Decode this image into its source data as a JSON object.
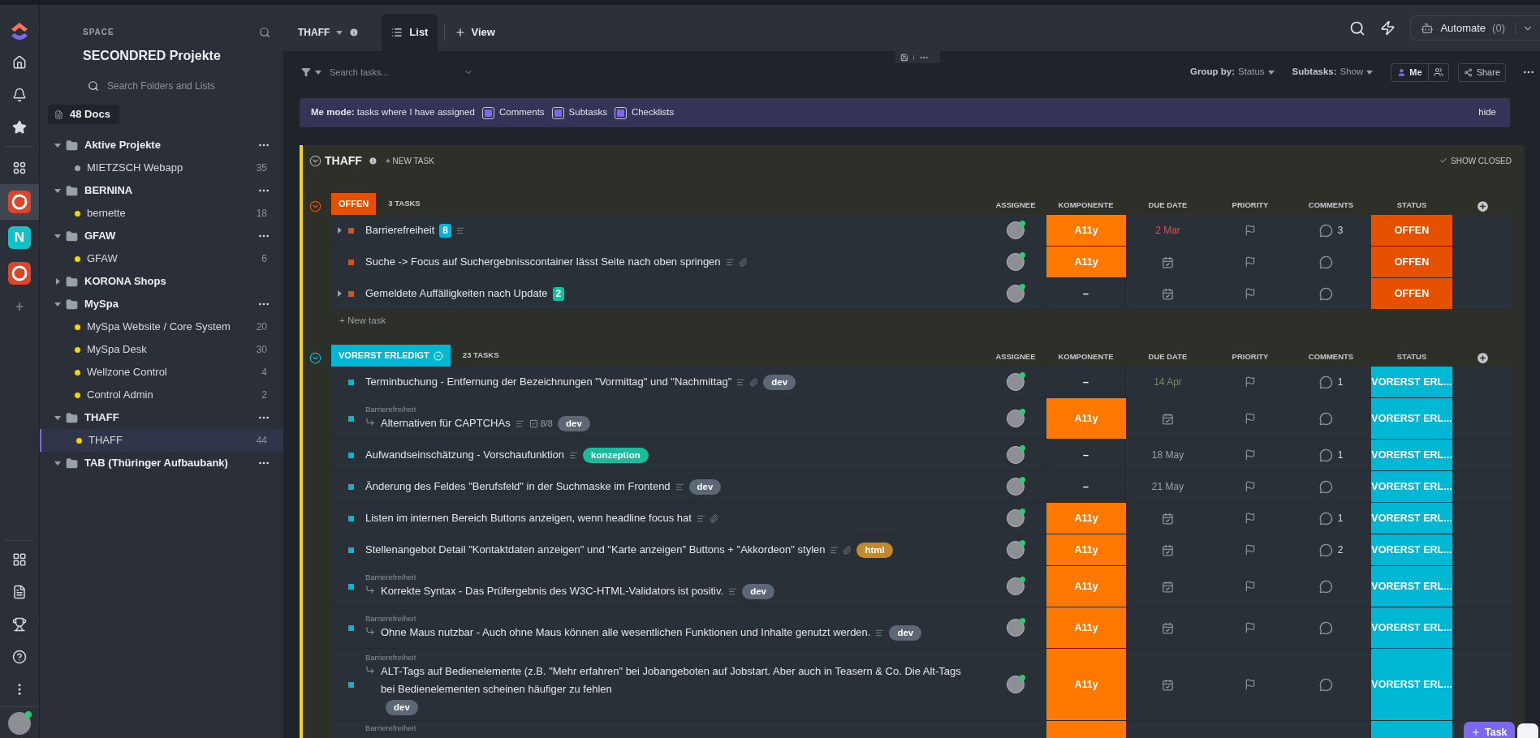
{
  "rail": {
    "spaces": [
      {
        "kind": "logo",
        "selected": true
      },
      {
        "kind": "letter",
        "text": "N",
        "selected": false
      },
      {
        "kind": "logo",
        "selected": false
      }
    ]
  },
  "sidebar": {
    "label": "SPACE",
    "title": "SECONDRED Projekte",
    "search_placeholder": "Search Folders and Lists",
    "docs": "48 Docs",
    "folders": [
      {
        "name": "Aktive Projekte",
        "expanded": true,
        "more": true,
        "children": [
          {
            "name": "MIETZSCH Webapp",
            "count": "35",
            "color": "#a8a0a6",
            "selected": false
          }
        ]
      },
      {
        "name": "BERNINA",
        "expanded": true,
        "more": true,
        "children": [
          {
            "name": "bernette",
            "count": "18",
            "color": "#f5d40f",
            "selected": false
          }
        ]
      },
      {
        "name": "GFAW",
        "expanded": true,
        "more": true,
        "children": [
          {
            "name": "GFAW",
            "count": "6",
            "color": "#f5d40f",
            "selected": false
          }
        ]
      },
      {
        "name": "KORONA Shops",
        "expanded": false,
        "more": false
      },
      {
        "name": "MySpa",
        "expanded": true,
        "more": true,
        "children": [
          {
            "name": "MySpa Website / Core System",
            "count": "20",
            "color": "#f5d40f",
            "selected": false
          },
          {
            "name": "MySpa Desk",
            "count": "30",
            "color": "#f5d40f",
            "selected": false
          },
          {
            "name": "Wellzone Control",
            "count": "4",
            "color": "#f5d40f",
            "selected": false
          },
          {
            "name": "Control Admin",
            "count": "2",
            "color": "#f5d40f",
            "selected": false
          }
        ]
      },
      {
        "name": "THAFF",
        "expanded": true,
        "more": true,
        "children": [
          {
            "name": "THAFF",
            "count": "44",
            "color": "#f5d40f",
            "selected": true
          }
        ]
      },
      {
        "name": "TAB (Thüringer Aufbaubank)",
        "expanded": true,
        "more": true
      }
    ]
  },
  "header": {
    "list_name": "THAFF",
    "tabs": [
      {
        "label": "List",
        "selected": true
      }
    ],
    "add_view": "View",
    "automate": {
      "label": "Automate",
      "count": "(0)"
    }
  },
  "toolbar": {
    "search_placeholder": "Search tasks...",
    "group_by": {
      "label": "Group by:",
      "value": "Status"
    },
    "subtasks": {
      "label": "Subtasks:",
      "value": "Show"
    },
    "me": "Me",
    "share": "Share"
  },
  "me_mode": {
    "text": "**Me mode:** tasks where I have assigned",
    "options": [
      {
        "label": "Comments",
        "checked": true
      },
      {
        "label": "Subtasks",
        "checked": true
      },
      {
        "label": "Checklists",
        "checked": true
      }
    ],
    "hide": "hide"
  },
  "list": {
    "title": "THAFF",
    "new_task": "+ NEW TASK",
    "show_closed": "SHOW CLOSED",
    "groups": [
      {
        "status": "OFFEN",
        "color": "#e65100",
        "done": false,
        "count": "3 TASKS",
        "columns": [
          "ASSIGNEE",
          "KOMPONENTE",
          "DUE DATE",
          "PRIORITY",
          "COMMENTS",
          "STATUS"
        ],
        "new_task": "+ New task",
        "tasks": [
          {
            "name": "Barrierefreiheit",
            "expandable": true,
            "subtasks": {
              "text": "8",
              "color": "#00b5d8"
            },
            "description": true,
            "attachment": false,
            "komponente": {
              "text": "A11y",
              "color": "#ff7800"
            },
            "due": {
              "text": "2 Mar",
              "kind": "overdue"
            },
            "comments": "3",
            "status": "OFFEN"
          },
          {
            "name": "Suche -> Focus auf Suchergebnisscontainer lässt Seite nach oben springen",
            "expandable": false,
            "description": true,
            "attachment": true,
            "komponente": {
              "text": "A11y",
              "color": "#ff7800"
            },
            "status": "OFFEN"
          },
          {
            "name": "Gemeldete Auffälligkeiten nach Update",
            "expandable": true,
            "subtasks": {
              "text": "2",
              "color": "#1bbc9c"
            },
            "description": false,
            "attachment": false,
            "komponente": {
              "text": "–"
            },
            "status": "OFFEN"
          }
        ]
      },
      {
        "status": "VORERST ERLEDIGT",
        "color": "#00b8d4",
        "done": true,
        "count": "23 TASKS",
        "columns": [
          "ASSIGNEE",
          "KOMPONENTE",
          "DUE DATE",
          "PRIORITY",
          "COMMENTS",
          "STATUS"
        ],
        "tasks": [
          {
            "name": "Terminbuchung - Entfernung der Bezeichnungen \"Vormittag\" und \"Nachmittag\"",
            "expandable": false,
            "description": true,
            "attachment": true,
            "tags": [
              {
                "label": "dev",
                "color": "#5d6877"
              }
            ],
            "komponente": {
              "text": "–"
            },
            "due": {
              "text": "14 Apr",
              "kind": "done"
            },
            "comments": "1",
            "status": "VORERST ERL..."
          },
          {
            "parent": "Barrierefreiheit",
            "name": "Alternativen für CAPTCHAs",
            "expandable": false,
            "description": true,
            "attachment": false,
            "checklist": "8/8",
            "tags": [
              {
                "label": "dev",
                "color": "#5d6877"
              }
            ],
            "komponente": {
              "text": "A11y",
              "color": "#ff7800"
            },
            "status": "VORERST ERL..."
          },
          {
            "name": "Aufwandseinschätzung - Vorschaufunktion",
            "expandable": false,
            "description": true,
            "attachment": false,
            "tags": [
              {
                "label": "konzeption",
                "color": "#1bbc9c"
              }
            ],
            "komponente": {
              "text": "–"
            },
            "due": {
              "text": "18 May",
              "kind": "normal"
            },
            "comments": "1",
            "status": "VORERST ERL..."
          },
          {
            "name": "Änderung des Feldes \"Berufsfeld\" in der Suchmaske im Frontend",
            "expandable": false,
            "description": true,
            "attachment": false,
            "tags": [
              {
                "label": "dev",
                "color": "#5d6877"
              }
            ],
            "komponente": {
              "text": "–"
            },
            "due": {
              "text": "21 May",
              "kind": "normal"
            },
            "status": "VORERST ERL..."
          },
          {
            "name": "Listen im internen Bereich Buttons anzeigen, wenn headline focus hat",
            "expandable": false,
            "description": true,
            "attachment": true,
            "komponente": {
              "text": "A11y",
              "color": "#ff7800"
            },
            "comments": "1",
            "status": "VORERST ERL..."
          },
          {
            "name": "Stellenangebot Detail \"Kontaktdaten anzeigen\" und \"Karte anzeigen\" Buttons + \"Akkordeon\" stylen",
            "expandable": false,
            "description": true,
            "attachment": true,
            "tags": [
              {
                "label": "html",
                "color": "#c4892c"
              }
            ],
            "komponente": {
              "text": "A11y",
              "color": "#ff7800"
            },
            "comments": "2",
            "status": "VORERST ERL..."
          },
          {
            "parent": "Barrierefreiheit",
            "name": "Korrekte Syntax - Das Prüfergebnis des W3C-HTML-Validators ist positiv.",
            "expandable": false,
            "description": true,
            "attachment": false,
            "tags": [
              {
                "label": "dev",
                "color": "#5d6877"
              }
            ],
            "komponente": {
              "text": "A11y",
              "color": "#ff7800"
            },
            "status": "VORERST ERL..."
          },
          {
            "parent": "Barrierefreiheit",
            "name": "Ohne Maus nutzbar - Auch ohne Maus können alle wesentlichen Funktionen und Inhalte genutzt werden.",
            "expandable": false,
            "description": true,
            "attachment": false,
            "tags": [
              {
                "label": "dev",
                "color": "#5d6877"
              }
            ],
            "komponente": {
              "text": "A11y",
              "color": "#ff7800"
            },
            "status": "VORERST ERL..."
          },
          {
            "parent": "Barrierefreiheit",
            "name": "ALT-Tags auf Bedienelemente (z.B. \"Mehr erfahren\" bei Jobangeboten auf Jobstart. Aber auch in Teasern & Co. Die Alt-Tags bei Bedienelementen scheinen häufiger zu fehlen",
            "expandable": false,
            "description": false,
            "attachment": false,
            "tags": [
              {
                "label": "dev",
                "color": "#5d6877"
              }
            ],
            "komponente": {
              "text": "A11y",
              "color": "#ff7800"
            },
            "status": "VORERST ERL..."
          },
          {
            "parent": "Barrierefreiheit",
            "cut": true,
            "komponente": {
              "color": "#ff7800"
            }
          }
        ]
      }
    ]
  },
  "floating_button": "Task"
}
